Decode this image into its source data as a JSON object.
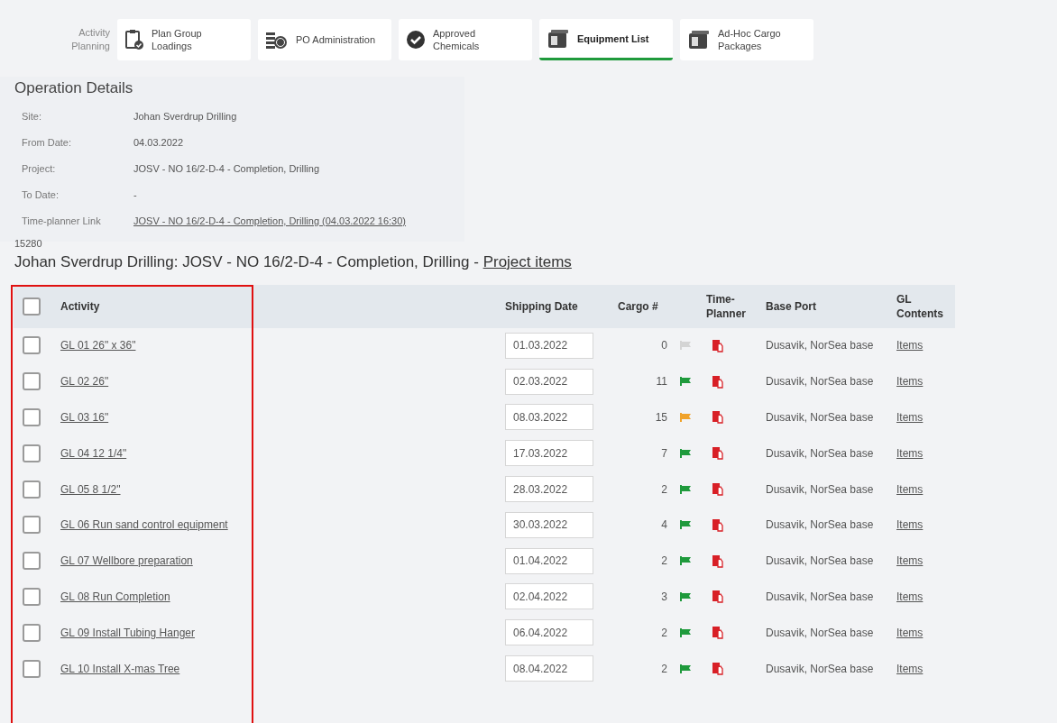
{
  "nav": {
    "label": "Activity Planning",
    "tabs": [
      {
        "label": "Plan Group Loadings",
        "kind": "clipboard",
        "selected": false
      },
      {
        "label": "PO Administration",
        "kind": "coins",
        "selected": false
      },
      {
        "label": "Approved Chemicals",
        "kind": "check",
        "selected": false
      },
      {
        "label": "Equipment List",
        "kind": "equipment",
        "selected": true
      },
      {
        "label": "Ad-Hoc Cargo Packages",
        "kind": "equipment",
        "selected": false
      }
    ]
  },
  "operation_details": {
    "title": "Operation Details",
    "rows": [
      {
        "label": "Site:",
        "value": "Johan Sverdrup Drilling",
        "kind": "text"
      },
      {
        "label": "From Date:",
        "value": "04.03.2022",
        "kind": "text"
      },
      {
        "label": "Project:",
        "value": "JOSV - NO 16/2-D-4 - Completion, Drilling",
        "kind": "text"
      },
      {
        "label": "To Date:",
        "value": "-",
        "kind": "text"
      },
      {
        "label": "Time-planner Link",
        "value": "JOSV - NO 16/2-D-4 - Completion, Drilling (04.03.2022 16:30)",
        "kind": "link"
      }
    ]
  },
  "record_id": "15280",
  "heading": {
    "text": "Johan Sverdrup Drilling: JOSV - NO 16/2-D-4 - Completion, Drilling - ",
    "link": "Project items"
  },
  "table": {
    "select_all_checked": false,
    "columns": [
      "Activity",
      "Shipping Date",
      "Cargo #",
      "Time-Planner",
      "Base Port",
      "GL Contents"
    ],
    "rows": [
      {
        "checked": false,
        "activity": "GL 01 26\" x 36\"",
        "shipping_date": "01.03.2022",
        "cargo": "0",
        "color": "#d4d4d4",
        "base_port": "Dusavik, NorSea base",
        "contents": "Items"
      },
      {
        "checked": false,
        "activity": "GL 02 26\"",
        "shipping_date": "02.03.2022",
        "cargo": "11",
        "color": "#1f9a3c",
        "base_port": "Dusavik, NorSea base",
        "contents": "Items"
      },
      {
        "checked": false,
        "activity": "GL 03 16\"",
        "shipping_date": "08.03.2022",
        "cargo": "15",
        "color": "#f0a22a",
        "base_port": "Dusavik, NorSea base",
        "contents": "Items"
      },
      {
        "checked": false,
        "activity": "GL 04 12 1/4\"",
        "shipping_date": "17.03.2022",
        "cargo": "7",
        "color": "#1f9a3c",
        "base_port": "Dusavik, NorSea base",
        "contents": "Items"
      },
      {
        "checked": false,
        "activity": "GL 05 8 1/2\"",
        "shipping_date": "28.03.2022",
        "cargo": "2",
        "color": "#1f9a3c",
        "base_port": "Dusavik, NorSea base",
        "contents": "Items"
      },
      {
        "checked": false,
        "activity": "GL 06 Run sand control equipment",
        "shipping_date": "30.03.2022",
        "cargo": "4",
        "color": "#1f9a3c",
        "base_port": "Dusavik, NorSea base",
        "contents": "Items"
      },
      {
        "checked": false,
        "activity": "GL 07 Wellbore preparation",
        "shipping_date": "01.04.2022",
        "cargo": "2",
        "color": "#1f9a3c",
        "base_port": "Dusavik, NorSea base",
        "contents": "Items"
      },
      {
        "checked": false,
        "activity": "GL 08 Run Completion",
        "shipping_date": "02.04.2022",
        "cargo": "3",
        "color": "#1f9a3c",
        "base_port": "Dusavik, NorSea base",
        "contents": "Items"
      },
      {
        "checked": false,
        "activity": "GL 09 Install Tubing Hanger",
        "shipping_date": "06.04.2022",
        "cargo": "2",
        "color": "#1f9a3c",
        "base_port": "Dusavik, NorSea base",
        "contents": "Items"
      },
      {
        "checked": false,
        "activity": "GL 10 Install X-mas Tree",
        "shipping_date": "08.04.2022",
        "cargo": "2",
        "color": "#1f9a3c",
        "base_port": "Dusavik, NorSea base",
        "contents": "Items"
      }
    ]
  }
}
